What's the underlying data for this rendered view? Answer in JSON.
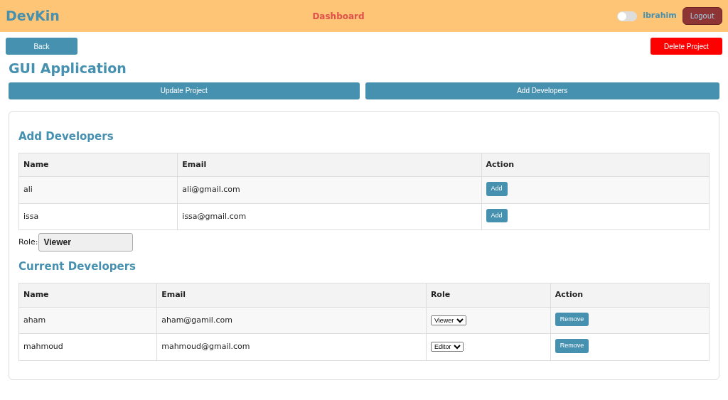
{
  "navbar": {
    "brand": "DevKin",
    "title": "Dashboard",
    "theme_toggle": {
      "on": false
    },
    "user": "ibrahim",
    "logout": "Logout"
  },
  "back": "Back",
  "delete": "Delete Project",
  "project_title": "GUI Application",
  "actions": [
    "Update Project",
    "Add Developers"
  ],
  "add_section": {
    "title": "Add Developers",
    "columns": [
      "Name",
      "Email",
      "Action"
    ],
    "rows": [
      {
        "name": "ali",
        "email": "ali@gmail.com",
        "action": "Add"
      },
      {
        "name": "issa",
        "email": "issa@gmail.com",
        "action": "Add"
      }
    ],
    "role_label": "Role:",
    "role_value": "Viewer"
  },
  "current_section": {
    "title": "Current Developers",
    "columns": [
      "Name",
      "Email",
      "Role",
      "Action"
    ],
    "rows": [
      {
        "name": "aham",
        "email": "aham@gamil.com",
        "role": "Viewer",
        "action": "Remove"
      },
      {
        "name": "mahmoud",
        "email": "mahmoud@gmail.com",
        "role": "Editor",
        "action": "Remove"
      }
    ]
  }
}
